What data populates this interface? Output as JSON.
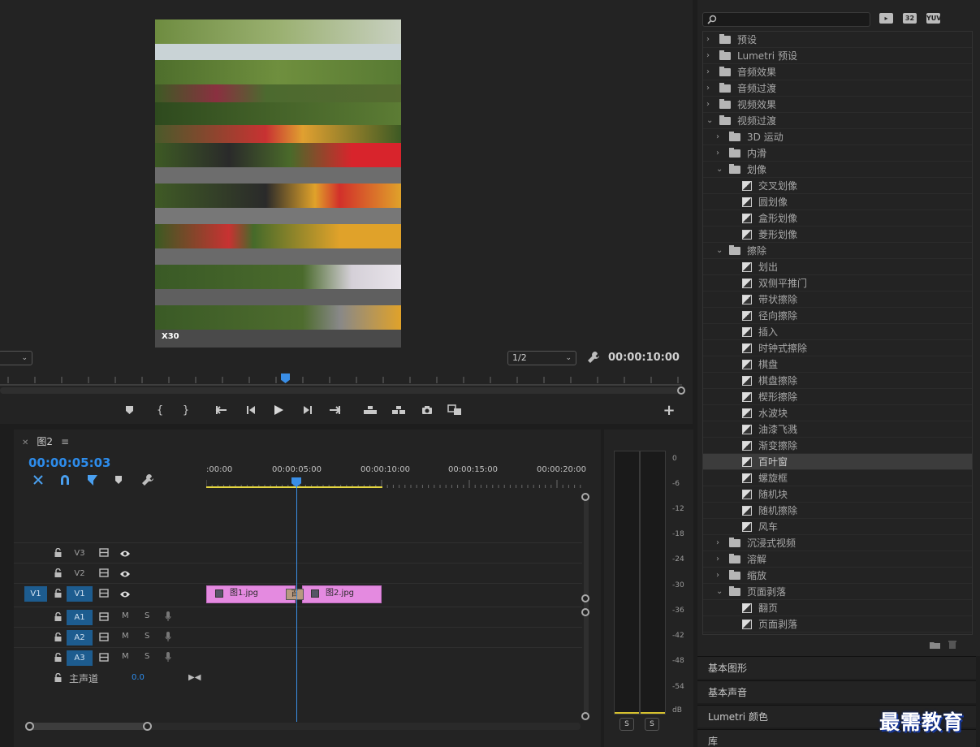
{
  "monitor": {
    "zoom_value": "",
    "resolution_value": "1/2",
    "duration": "00:00:10:00",
    "watermark_text": "X30"
  },
  "sequence": {
    "tab_name": "图2",
    "timecode": "00:00:05:03",
    "ruler_labels": [
      ":00:00",
      "00:00:05:00",
      "00:00:10:00",
      "00:00:15:00",
      "00:00:20:00"
    ],
    "tracks": {
      "v3": "V3",
      "v2": "V2",
      "v1": "V1",
      "v1_source": "V1",
      "a1": "A1",
      "a2": "A2",
      "a3": "A3",
      "mute": "M",
      "solo": "S"
    },
    "clip1_name": "图1.jpg",
    "clip2_name": "图2.jpg",
    "transition_label": "百",
    "master_label": "主声道",
    "master_value": "0.0"
  },
  "meter": {
    "db_labels": [
      "0",
      "-6",
      "-12",
      "-18",
      "-24",
      "-30",
      "-36",
      "-42",
      "-48",
      "-54",
      "dB"
    ],
    "solo_label": "S"
  },
  "effects": {
    "badges": [
      "32",
      "YUV"
    ],
    "items": [
      {
        "label": "预设",
        "depth": 0,
        "kind": "folder",
        "open": false
      },
      {
        "label": "Lumetri 预设",
        "depth": 0,
        "kind": "folder",
        "open": false
      },
      {
        "label": "音频效果",
        "depth": 0,
        "kind": "folder",
        "open": false
      },
      {
        "label": "音频过渡",
        "depth": 0,
        "kind": "folder",
        "open": false
      },
      {
        "label": "视频效果",
        "depth": 0,
        "kind": "folder",
        "open": false
      },
      {
        "label": "视频过渡",
        "depth": 0,
        "kind": "folder",
        "open": true
      },
      {
        "label": "3D 运动",
        "depth": 1,
        "kind": "folder",
        "open": false
      },
      {
        "label": "内滑",
        "depth": 1,
        "kind": "folder",
        "open": false
      },
      {
        "label": "划像",
        "depth": 1,
        "kind": "folder",
        "open": true
      },
      {
        "label": "交叉划像",
        "depth": 2,
        "kind": "effect"
      },
      {
        "label": "圆划像",
        "depth": 2,
        "kind": "effect"
      },
      {
        "label": "盒形划像",
        "depth": 2,
        "kind": "effect"
      },
      {
        "label": "菱形划像",
        "depth": 2,
        "kind": "effect"
      },
      {
        "label": "擦除",
        "depth": 1,
        "kind": "folder",
        "open": true
      },
      {
        "label": "划出",
        "depth": 2,
        "kind": "effect"
      },
      {
        "label": "双侧平推门",
        "depth": 2,
        "kind": "effect"
      },
      {
        "label": "带状擦除",
        "depth": 2,
        "kind": "effect"
      },
      {
        "label": "径向擦除",
        "depth": 2,
        "kind": "effect"
      },
      {
        "label": "插入",
        "depth": 2,
        "kind": "effect"
      },
      {
        "label": "时钟式擦除",
        "depth": 2,
        "kind": "effect"
      },
      {
        "label": "棋盘",
        "depth": 2,
        "kind": "effect"
      },
      {
        "label": "棋盘擦除",
        "depth": 2,
        "kind": "effect"
      },
      {
        "label": "楔形擦除",
        "depth": 2,
        "kind": "effect"
      },
      {
        "label": "水波块",
        "depth": 2,
        "kind": "effect"
      },
      {
        "label": "油漆飞溅",
        "depth": 2,
        "kind": "effect"
      },
      {
        "label": "渐变擦除",
        "depth": 2,
        "kind": "effect"
      },
      {
        "label": "百叶窗",
        "depth": 2,
        "kind": "effect",
        "selected": true
      },
      {
        "label": "螺旋框",
        "depth": 2,
        "kind": "effect"
      },
      {
        "label": "随机块",
        "depth": 2,
        "kind": "effect"
      },
      {
        "label": "随机擦除",
        "depth": 2,
        "kind": "effect"
      },
      {
        "label": "风车",
        "depth": 2,
        "kind": "effect"
      },
      {
        "label": "沉浸式视频",
        "depth": 1,
        "kind": "folder",
        "open": false
      },
      {
        "label": "溶解",
        "depth": 1,
        "kind": "folder",
        "open": false
      },
      {
        "label": "缩放",
        "depth": 1,
        "kind": "folder",
        "open": false
      },
      {
        "label": "页面剥落",
        "depth": 1,
        "kind": "folder",
        "open": true
      },
      {
        "label": "翻页",
        "depth": 2,
        "kind": "effect"
      },
      {
        "label": "页面剥落",
        "depth": 2,
        "kind": "effect"
      }
    ]
  },
  "panels": {
    "essential_graphics": "基本图形",
    "essential_sound": "基本声音",
    "lumetri_color": "Lumetri 颜色",
    "library": "库"
  },
  "logo_text": "最需教育"
}
